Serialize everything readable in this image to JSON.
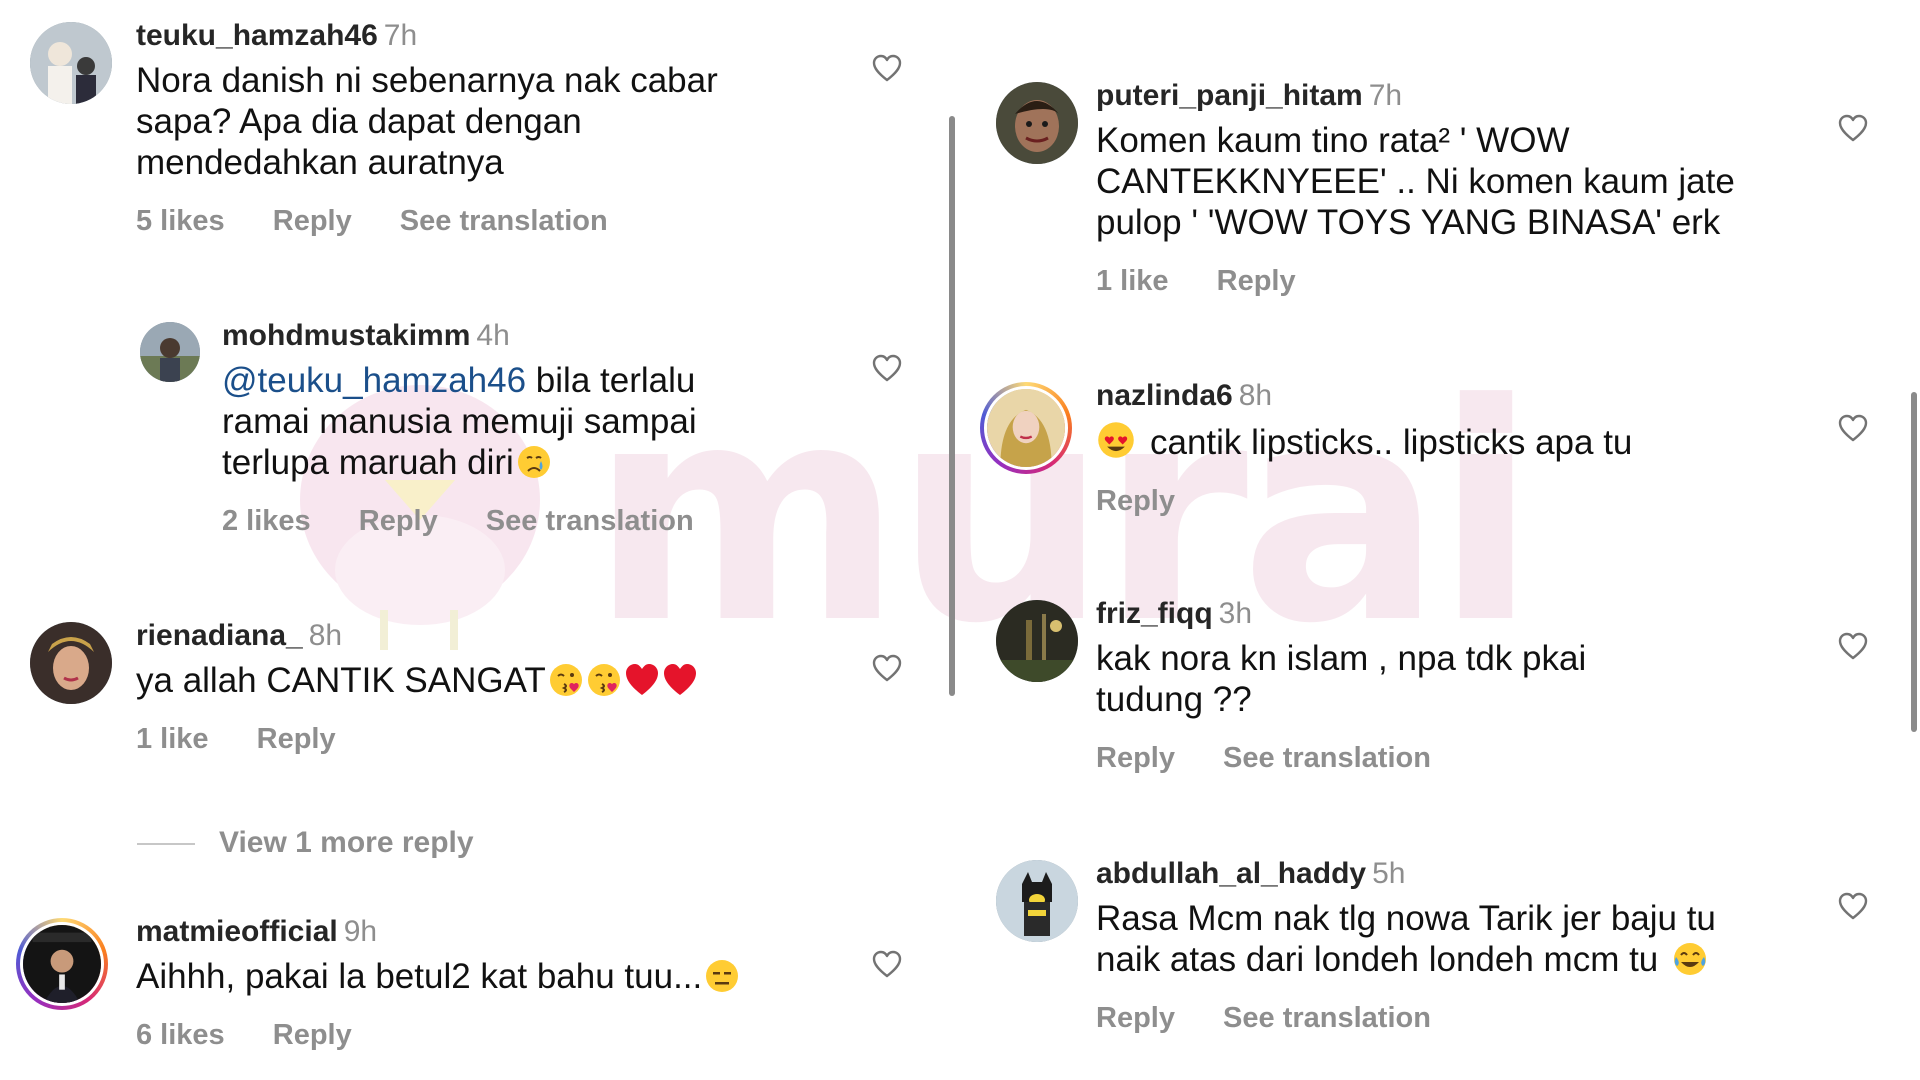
{
  "watermark": {
    "text": "murai"
  },
  "left_column": {
    "comments": [
      {
        "username": "teuku_hamzah46",
        "time": "7h",
        "text_lines": [
          "Nora danish ni sebenarnya nak cabar",
          "sapa? Apa dia dapat dengan",
          "mendedahkan auratnya"
        ],
        "likes": "5 likes",
        "reply": "Reply",
        "see_translation": "See translation"
      },
      {
        "username": "mohdmustakimm",
        "time": "4h",
        "mention": "@teuku_hamzah46",
        "text_lines": [
          "bila terlalu",
          "ramai manusia memuji sampai",
          "terlupa maruah diri"
        ],
        "emojis": [
          "crying-face"
        ],
        "likes": "2 likes",
        "reply": "Reply",
        "see_translation": "See translation"
      },
      {
        "username": "rienadiana_",
        "time": "8h",
        "text_lines": [
          "ya allah CANTIK SANGAT"
        ],
        "emojis": [
          "kissing-face",
          "kissing-face",
          "red-heart",
          "red-heart"
        ],
        "likes": "1 like",
        "reply": "Reply"
      },
      {
        "username": "matmieofficial",
        "time": "9h",
        "text_lines": [
          "Aihhh, pakai la betul2 kat bahu tuu..."
        ],
        "emojis": [
          "expressionless-face"
        ],
        "likes": "6 likes",
        "reply": "Reply"
      }
    ],
    "view_more": "View 1 more reply"
  },
  "right_column": {
    "comments": [
      {
        "username": "puteri_panji_hitam",
        "time": "7h",
        "text_lines": [
          "Komen kaum tino rata² ' WOW",
          "CANTEKKNYEEE' .. Ni komen kaum jate",
          "pulop ' 'WOW TOYS YANG BINASA' erk"
        ],
        "likes": "1 like",
        "reply": "Reply"
      },
      {
        "username": "nazlinda6",
        "time": "8h",
        "text_lines": [
          "cantik lipsticks.. lipsticks apa tu"
        ],
        "emojis": [
          "heart-eyes-face"
        ],
        "reply": "Reply"
      },
      {
        "username": "friz_fiqq",
        "time": "3h",
        "text_lines": [
          "kak nora kn islam , npa tdk pkai",
          "tudung ??"
        ],
        "reply": "Reply",
        "see_translation": "See translation"
      },
      {
        "username": "abdullah_al_haddy",
        "time": "5h",
        "text_lines": [
          "Rasa Mcm nak tlg nowa Tarik jer baju tu",
          "naik atas dari londeh londeh mcm tu"
        ],
        "emojis": [
          "tears-of-joy-face"
        ],
        "reply": "Reply",
        "see_translation": "See translation"
      }
    ]
  },
  "colors": {
    "username": "#262626",
    "meta_gray": "#8e8e8e",
    "mention": "#1b4f8a",
    "watermark": "#f1d7e2"
  }
}
